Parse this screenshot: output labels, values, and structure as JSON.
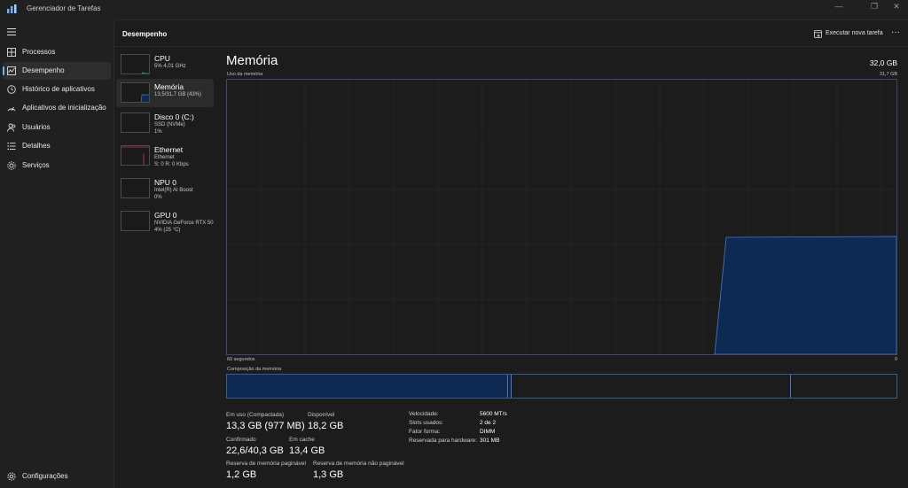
{
  "app": {
    "title": "Gerenciador de Tarefas"
  },
  "window_controls": {
    "minimize": "—",
    "restore": "❐",
    "close": "✕"
  },
  "sidebar": {
    "items": [
      {
        "label": "Processos",
        "icon": "grid-icon"
      },
      {
        "label": "Desempenho",
        "icon": "performance-icon"
      },
      {
        "label": "Histórico de aplicativos",
        "icon": "history-icon"
      },
      {
        "label": "Aplicativos de inicialização",
        "icon": "startup-icon"
      },
      {
        "label": "Usuários",
        "icon": "users-icon"
      },
      {
        "label": "Detalhes",
        "icon": "details-icon"
      },
      {
        "label": "Serviços",
        "icon": "services-icon"
      }
    ],
    "settings": {
      "label": "Configurações",
      "icon": "gear-icon"
    }
  },
  "header": {
    "title": "Desempenho",
    "run_task": "Executar nova tarefa",
    "more": "···"
  },
  "perf_items": [
    {
      "title": "CPU",
      "sub1": "5%  4,01 GHz",
      "sub2": ""
    },
    {
      "title": "Memória",
      "sub1": "13,5/31,7 GB (43%)",
      "sub2": ""
    },
    {
      "title": "Disco 0 (C:)",
      "sub1": "SSD (NVMe)",
      "sub2": "1%"
    },
    {
      "title": "Ethernet",
      "sub1": "Ethernet",
      "sub2": "S: 0  R: 0 Kbps"
    },
    {
      "title": "NPU 0",
      "sub1": "Intel(R) AI Boost",
      "sub2": "0%"
    },
    {
      "title": "GPU 0",
      "sub1": "NVIDIA GeForce RTX 50",
      "sub2": "4% (25 °C)"
    }
  ],
  "memory": {
    "title": "Memória",
    "total": "32,0 GB",
    "usage_label": "Uso da memória",
    "usage_max": "31,7 GB",
    "axis_left": "60 segundos",
    "axis_right": "0",
    "composition_label": "Composição da memória",
    "stats": {
      "in_use_label": "Em uso (Compactada)",
      "in_use_value": "13,3 GB (977 MB)",
      "available_label": "Disponível",
      "available_value": "18,2 GB",
      "committed_label": "Confirmado",
      "committed_value": "22,6/40,3 GB",
      "cached_label": "Em cache",
      "cached_value": "13,4 GB",
      "paged_label": "Reserva de memória paginável",
      "paged_value": "1,2 GB",
      "nonpaged_label": "Reserva de memória não paginável",
      "nonpaged_value": "1,3 GB"
    },
    "specs": [
      {
        "label": "Velocidade:",
        "value": "5600 MT/s"
      },
      {
        "label": "Slots usados:",
        "value": "2 de 2"
      },
      {
        "label": "Fator forma:",
        "value": "DIMM"
      },
      {
        "label": "Reservada para hardware:",
        "value": "301 MB"
      }
    ],
    "usage_fraction": 0.43
  },
  "colors": {
    "accent": "#6bb2ff",
    "memory_fill": "#0e2a52",
    "memory_line": "#4a78c8"
  }
}
